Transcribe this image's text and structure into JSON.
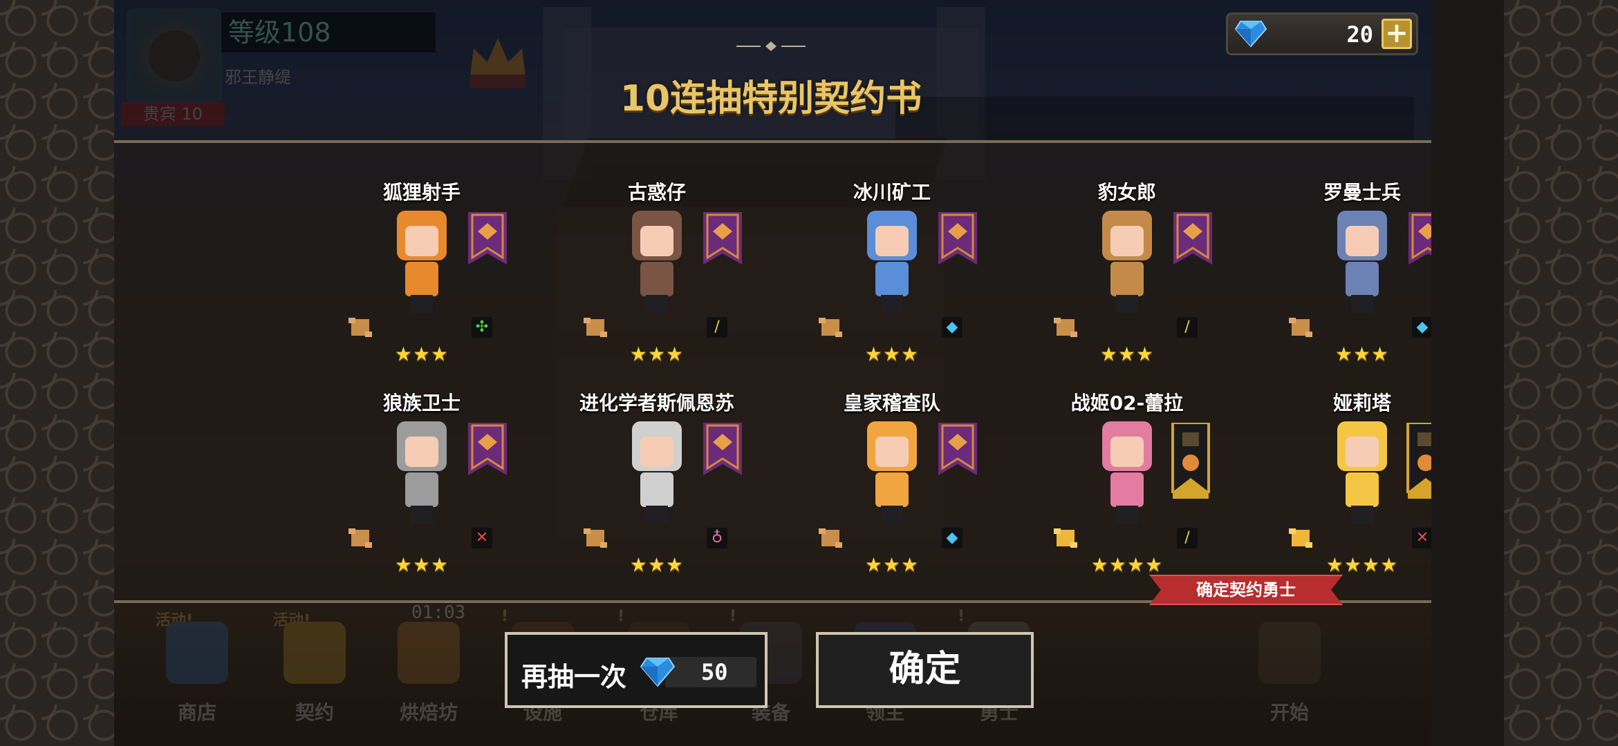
{
  "player": {
    "level": "等级108",
    "name": "邪王静缇",
    "rank": "贵宾 10",
    "crown_label": "贵宾 10"
  },
  "currency": {
    "gems": "20",
    "plus": "+"
  },
  "title": "10连抽特别契约书",
  "heroes": [
    {
      "name": "狐狸射手",
      "stars": "★★★",
      "element": "wind-icon",
      "banner": "purple",
      "sprite_color": "#e8892e"
    },
    {
      "name": "古惑仔",
      "stars": "★★★",
      "element": "sword-icon",
      "banner": "purple",
      "sprite_color": "#7a5445"
    },
    {
      "name": "冰川矿工",
      "stars": "★★★",
      "element": "water-icon",
      "banner": "purple",
      "sprite_color": "#5b8ed8"
    },
    {
      "name": "豹女郎",
      "stars": "★★★",
      "element": "sword-icon",
      "banner": "purple",
      "sprite_color": "#c48a4a"
    },
    {
      "name": "罗曼士兵",
      "stars": "★★★",
      "element": "water-icon",
      "banner": "purple",
      "sprite_color": "#6d82b4"
    },
    {
      "name": "狼族卫士",
      "stars": "★★★",
      "element": "fire-icon",
      "banner": "purple",
      "sprite_color": "#9c9c9c"
    },
    {
      "name": "进化学者斯佩恩苏",
      "stars": "★★★",
      "element": "poison-icon",
      "banner": "purple",
      "sprite_color": "#d0d0d0"
    },
    {
      "name": "皇家稽查队",
      "stars": "★★★",
      "element": "water-icon",
      "banner": "purple",
      "sprite_color": "#f0a540"
    },
    {
      "name": "战姬02-蕾拉",
      "stars": "★★★★",
      "element": "sword-icon",
      "banner": "gold",
      "sprite_color": "#e27ca0"
    },
    {
      "name": "娅莉塔",
      "stars": "★★★★",
      "element": "fire-icon",
      "banner": "gold",
      "sprite_color": "#f5c645"
    }
  ],
  "confirm_ribbon": "确定契约勇士",
  "nav": [
    {
      "label": "商店",
      "badge": "活动!"
    },
    {
      "label": "契约",
      "badge": "活动!"
    },
    {
      "label": "烘焙坊",
      "badge": ""
    },
    {
      "label": "设施",
      "badge": "!"
    },
    {
      "label": "仓库",
      "badge": "!"
    },
    {
      "label": "装备",
      "badge": "!"
    },
    {
      "label": "领主",
      "badge": ""
    },
    {
      "label": "勇士",
      "badge": "!"
    },
    {
      "label": "开始",
      "badge": ""
    }
  ],
  "timer": "01:03",
  "buttons": {
    "redraw_label": "再抽一次",
    "redraw_cost": "50",
    "ok_label": "确定"
  },
  "colors": {
    "title_gold": "#e8c567",
    "star_yellow": "#ffd53a",
    "ribbon_red": "#b82d2d",
    "banner_purple": "#6b2a7a",
    "banner_gold": "#d4a52a"
  }
}
